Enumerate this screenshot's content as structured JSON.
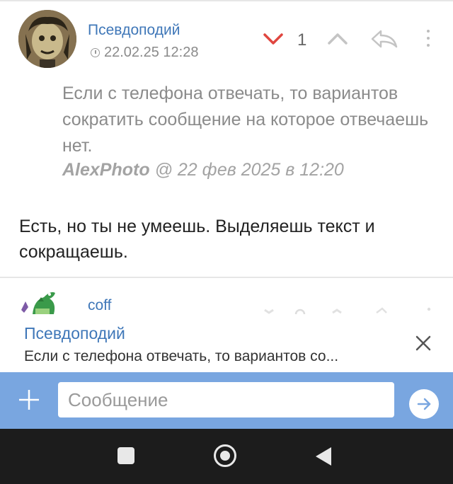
{
  "post1": {
    "author": "Псевдоподий",
    "date": "22.02.25 12:28",
    "vote_count": "1",
    "quote": {
      "text": "Если с телефона отвечать, то вариантов сократить сообщение на которое отвечаешь нет.",
      "author": "AlexPhoto",
      "meta": "@ 22 фев 2025 в 12:20"
    },
    "body": "Есть, но ты не умеешь. Выделяешь текст и сокращаешь."
  },
  "post2": {
    "author": "coff"
  },
  "reply_preview": {
    "author": "Псевдоподий",
    "snippet": "Если с телефона отвечать, то вариантов со..."
  },
  "composer": {
    "placeholder": "Сообщение"
  },
  "colors": {
    "accent": "#3f77b8",
    "composer_bar": "#79a6e0",
    "downvote": "#e0463f",
    "navbar": "#1c1c1c"
  }
}
